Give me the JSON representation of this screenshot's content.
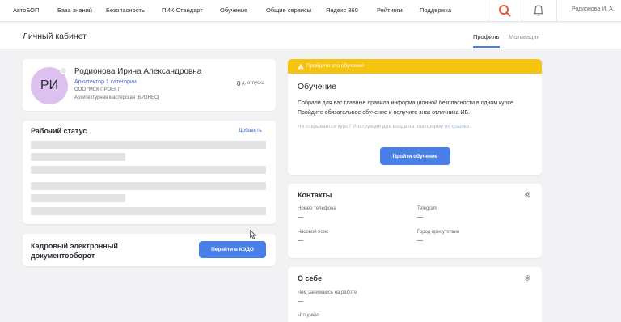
{
  "nav": {
    "items": [
      "АвтоБОП",
      "База знаний",
      "Безопасность",
      "ПИК-Стандарт",
      "Обучение",
      "Общие сервисы",
      "Яндекс 360",
      "Рейтинги",
      "Поддержка"
    ],
    "user": "Родионова И. А."
  },
  "header": {
    "title": "Личный кабинет",
    "tabs": [
      "Профиль",
      "Мотивация"
    ]
  },
  "profile": {
    "initials": "РИ",
    "name": "Родионова Ирина Александровна",
    "position": "Архитектор 1 категории",
    "company": "ООО \"МСК ПРОЕКТ\"",
    "department": "Архитектурная мастерская (БИЗНЕС)",
    "vacation_days": "0",
    "vacation_label": "д. отпуска"
  },
  "status": {
    "title": "Рабочий статус",
    "add_label": "Добавить"
  },
  "kedo": {
    "title": "Кадровый электронный документооборот",
    "button_label": "Перейти в КЭДО"
  },
  "training": {
    "banner": "Пройдите это обучение",
    "title": "Обучение",
    "description": "Собрали для вас главные правила информационной безопасности в одном курсе. Пройдите обязательное обучение и получите знак отличника ИБ.",
    "help_text": "Не открывается курс? Инструкция для входа на платформу",
    "help_link": "по ссылке.",
    "button_label": "Пройти обучение"
  },
  "contacts": {
    "title": "Контакты",
    "phone_label": "Номер телефона",
    "phone_value": "—",
    "telegram_label": "Telegram",
    "telegram_value": "—",
    "timezone_label": "Часовой пояс",
    "timezone_value": "—",
    "city_label": "Город присутствия",
    "city_value": "—"
  },
  "about": {
    "title": "О себе",
    "work_label": "Чем занимаюсь на работе",
    "work_value": "—",
    "skills_label": "Что умею"
  },
  "colors": {
    "accent": "#4a7fe8",
    "banner": "#f5c40f",
    "avatar": "#dcc1ee",
    "search": "#e8543e"
  },
  "icons": [
    "search-icon",
    "bell-icon",
    "warning-icon",
    "gear-icon",
    "cursor-icon"
  ]
}
